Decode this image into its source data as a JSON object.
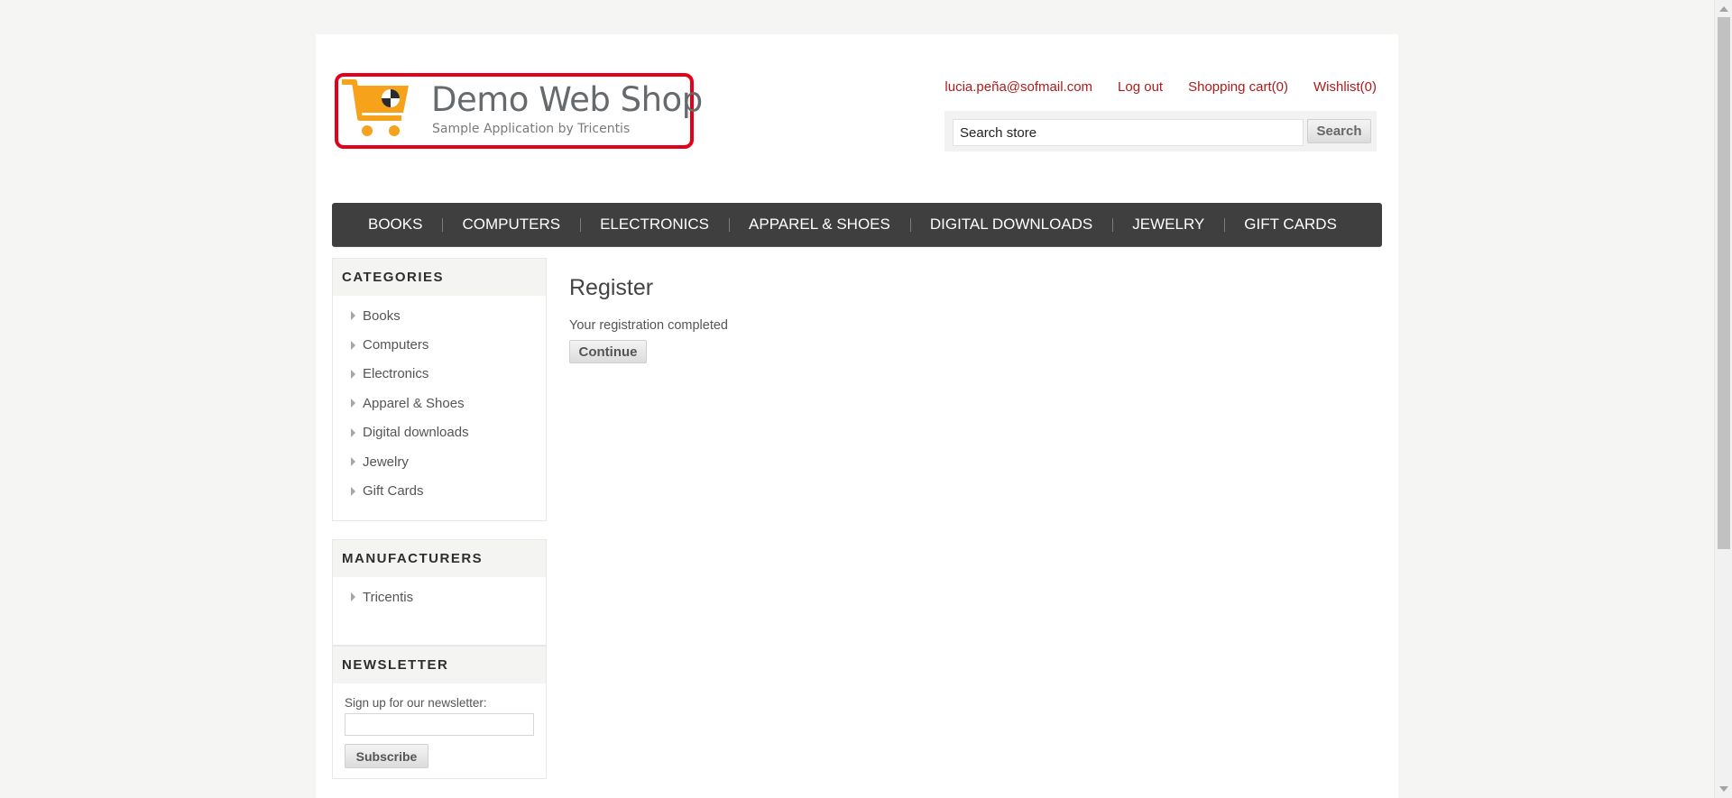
{
  "header": {
    "logo_title": "Demo Web Shop",
    "logo_subtitle": "Sample Application by Tricentis",
    "links": {
      "account": "lucia.peña@sofmail.com",
      "logout": "Log out",
      "cart": "Shopping cart(0)",
      "wishlist": "Wishlist(0)"
    },
    "search": {
      "placeholder": "Search store",
      "value": "Search store",
      "button": "Search"
    }
  },
  "top_menu": [
    "BOOKS",
    "COMPUTERS",
    "ELECTRONICS",
    "APPAREL & SHOES",
    "DIGITAL DOWNLOADS",
    "JEWELRY",
    "GIFT CARDS"
  ],
  "sidebar": {
    "categories": {
      "title": "CATEGORIES",
      "items": [
        "Books",
        "Computers",
        "Electronics",
        "Apparel & Shoes",
        "Digital downloads",
        "Jewelry",
        "Gift Cards"
      ]
    },
    "manufacturers": {
      "title": "MANUFACTURERS",
      "items": [
        "Tricentis"
      ]
    },
    "newsletter": {
      "title": "NEWSLETTER",
      "label": "Sign up for our newsletter:",
      "value": "",
      "button": "Subscribe"
    }
  },
  "main": {
    "title": "Register",
    "message": "Your registration completed",
    "continue_button": "Continue"
  },
  "colors": {
    "accent": "#e4001b",
    "link": "#b01a1a",
    "menu_bg": "#3f3f3f",
    "cart_orange": "#f7a21b"
  }
}
